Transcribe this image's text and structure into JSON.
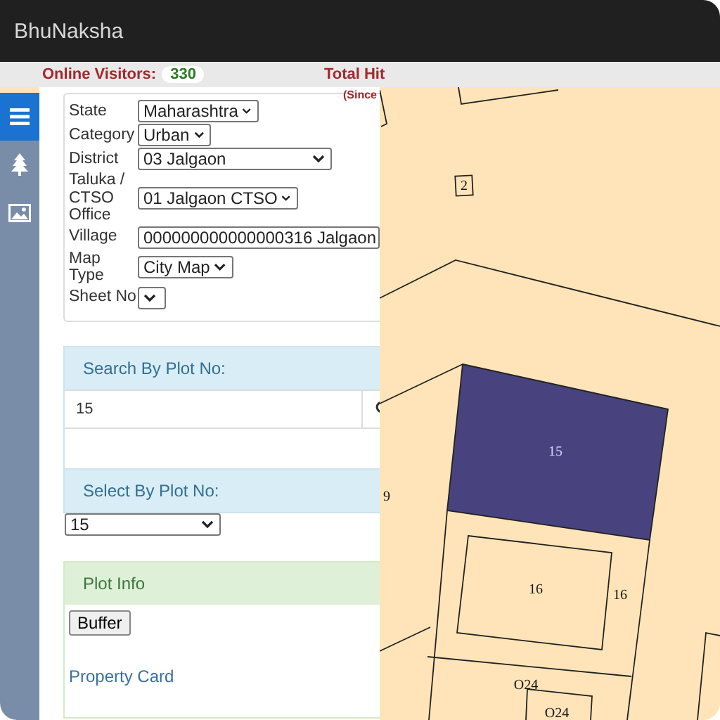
{
  "window": {
    "title": "BhuNaksha"
  },
  "stats_bar": {
    "online_visitors_label": "Online Visitors:",
    "online_visitors_count": "330",
    "total_hits_label": "Total Hit",
    "since_label": "(Since"
  },
  "sidebar": {
    "items": [
      {
        "kind": "menu",
        "selected": true
      },
      {
        "kind": "tree",
        "selected": false
      },
      {
        "kind": "image",
        "selected": false
      }
    ]
  },
  "location_form": {
    "fields": [
      {
        "label": "State",
        "value": "Maharashtra"
      },
      {
        "label": "Category",
        "value": "Urban"
      },
      {
        "label": "District",
        "value": "03 Jalgaon"
      },
      {
        "label": "Taluka / CTSO Office",
        "value": "01 Jalgaon CTSO"
      },
      {
        "label": "Village",
        "value": "000000000000000316 Jalgaon"
      },
      {
        "label": "Map Type",
        "value": "City Map"
      },
      {
        "label": "Sheet No"
      }
    ]
  },
  "search_by_plot": {
    "title": "Search By Plot No:",
    "value": "15"
  },
  "select_by_plot": {
    "title": "Select By Plot No:",
    "value": "15"
  },
  "plot_info": {
    "title": "Plot Info",
    "button": "Buffer",
    "link": "Property Card"
  },
  "map": {
    "plots": [
      {
        "label": "2",
        "selected": false
      },
      {
        "label": "15",
        "selected": true
      },
      {
        "label": "9",
        "selected": false
      },
      {
        "label": "16",
        "selected": false
      },
      {
        "label": "16",
        "selected": false
      },
      {
        "label": "O24",
        "selected": false
      },
      {
        "label": "O24",
        "selected": false
      }
    ]
  }
}
